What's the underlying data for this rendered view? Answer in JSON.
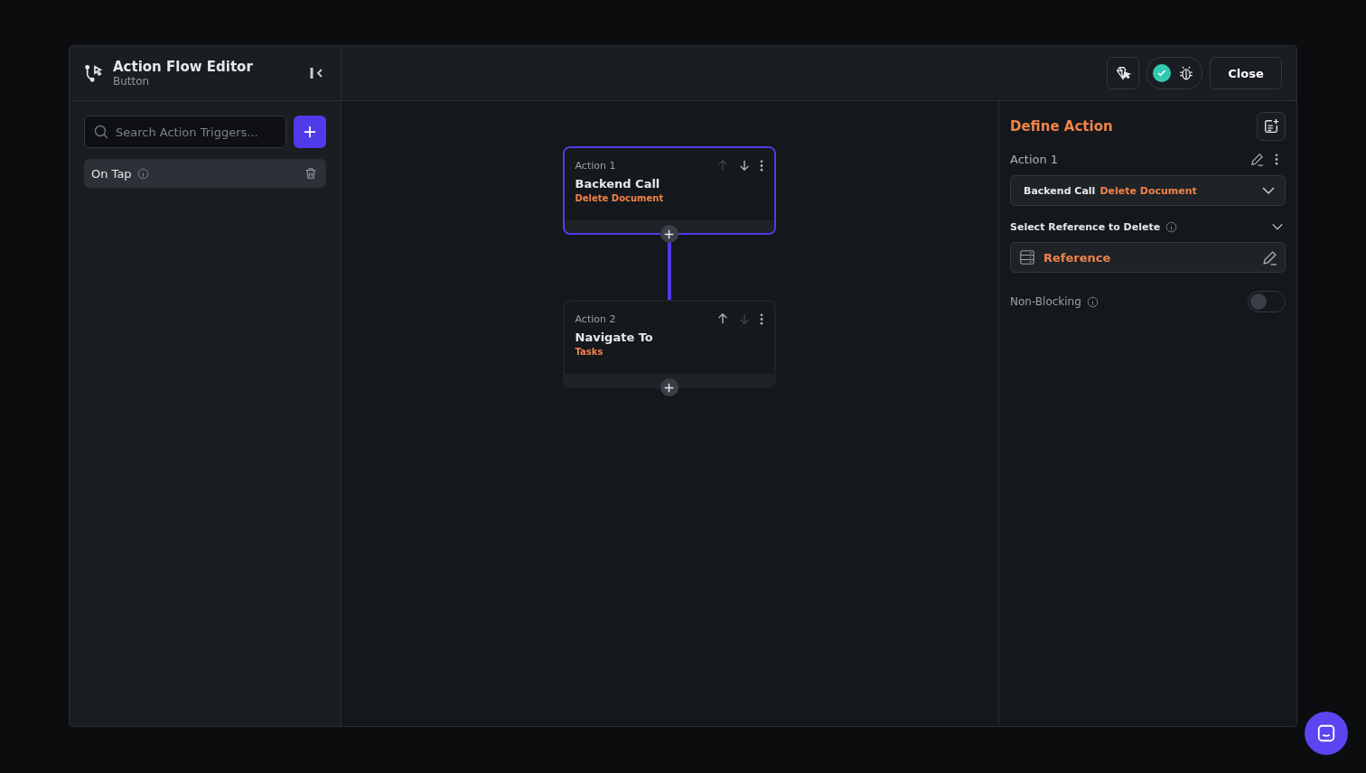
{
  "editor": {
    "title": "Action Flow Editor",
    "subtitle": "Button"
  },
  "toolbar": {
    "validation_ok": true,
    "close_label": "Close"
  },
  "triggers": {
    "search": {
      "placeholder": "Search Action Triggers..."
    },
    "items": [
      {
        "label": "On Tap",
        "selected": true
      }
    ]
  },
  "actions": [
    {
      "label": "Action 1",
      "title": "Backend Call",
      "subtitle": "Delete Document",
      "selected": true,
      "up_disabled": true,
      "down_disabled": false
    },
    {
      "label": "Action 2",
      "title": "Navigate To",
      "subtitle": "Tasks",
      "selected": false,
      "up_disabled": false,
      "down_disabled": true
    }
  ],
  "define_action": {
    "title": "Define Action",
    "action_label": "Action 1",
    "action_type": "Backend Call",
    "action_subtype": "Delete Document",
    "section_label": "Select Reference to Delete",
    "section_expanded": true,
    "reference": "Reference",
    "non_blocking_label": "Non-Blocking",
    "non_blocking_on": false
  }
}
